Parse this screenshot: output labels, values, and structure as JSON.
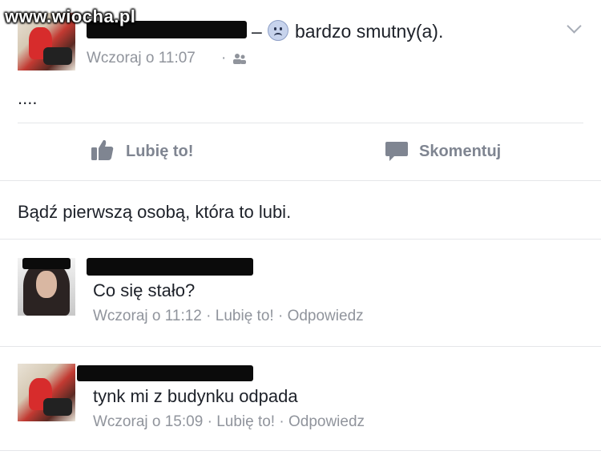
{
  "watermark": "www.wiocha.pl",
  "post": {
    "author_suffix": "–",
    "feeling_text": "bardzo smutny(a).",
    "timestamp": "Wczoraj o 11:07",
    "meta_separator": "·",
    "audience_icon": "friends-icon",
    "body": "....",
    "actions": {
      "like_label": "Lubię to!",
      "comment_label": "Skomentuj"
    },
    "likes_prompt": "Bądź pierwszą osobą, która to lubi."
  },
  "comments": [
    {
      "text": "Co się stało?",
      "timestamp": "Wczoraj o 11:12",
      "like_label": "Lubię to!",
      "reply_label": "Odpowiedz",
      "separator": "·"
    },
    {
      "text": "tynk mi z budynku odpada",
      "timestamp": "Wczoraj o 15:09",
      "like_label": "Lubię to!",
      "reply_label": "Odpowiedz",
      "separator": "·"
    }
  ],
  "colors": {
    "text": "#1d2129",
    "meta": "#90949c",
    "action": "#7f8591",
    "divider": "#e5e6e9",
    "redaction": "#0b0b0b"
  }
}
